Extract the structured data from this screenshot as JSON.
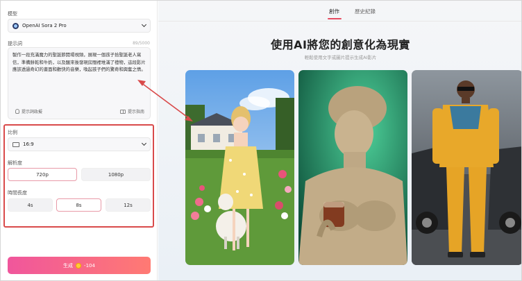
{
  "left_panel": {
    "model_label": "模型",
    "model_value": "OpenAI Sora 2 Pro",
    "prompt_label": "提示詞",
    "prompt_count": "89/5000",
    "prompt_text": "製作一段充滿魔力的聖誕節開場視頻，展現一個孩子拾聖誕老人寫信，準備餅乾和牛奶，以及醒來後發現房間裡堆滿了禮物，這段影片應該透過奇幻的畫面和歡快的音樂，喚起孩子們的驚奇和興奮之情。",
    "prompt_tool_left": "提示詞政擬",
    "prompt_tool_right": "提示指南",
    "ratio_label": "比例",
    "ratio_value": "16:9",
    "resolution_label": "解析度",
    "resolution_options": [
      "720p",
      "1080p"
    ],
    "resolution_selected": "720p",
    "duration_label": "時間長度",
    "duration_options": [
      "4s",
      "8s",
      "12s"
    ],
    "duration_selected": "8s",
    "generate_label": "生成",
    "generate_cost": "-104"
  },
  "right_panel": {
    "tabs": [
      "創作",
      "歷史紀錄"
    ],
    "active_tab": "創作",
    "headline": "使用AI將您的創意化為現實",
    "subline": "輕鬆使用文字或圖片提示生成AI影片"
  },
  "colors": {
    "accent": "#e64a5f",
    "highlight_box": "#d94a4a",
    "generate_gradient_start": "#f0569c",
    "generate_gradient_end": "#ff7a73"
  }
}
